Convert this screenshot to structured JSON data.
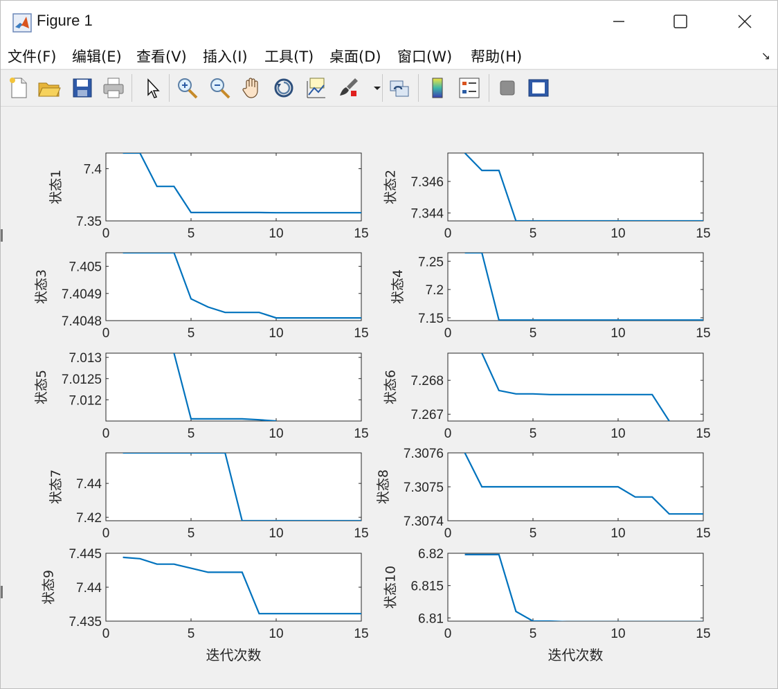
{
  "window": {
    "title": "Figure 1"
  },
  "menu": {
    "items": [
      "文件(F)",
      "编辑(E)",
      "查看(V)",
      "插入(I)",
      "工具(T)",
      "桌面(D)",
      "窗口(W)",
      "帮助(H)"
    ]
  },
  "toolbar": {
    "icons": [
      "new-figure-icon",
      "open-file-icon",
      "save-icon",
      "print-icon",
      "pointer-icon",
      "zoom-in-icon",
      "zoom-out-icon",
      "pan-hand-icon",
      "rotate-3d-icon",
      "data-cursor-icon",
      "brush-icon",
      "link-plot-icon",
      "colorbar-icon",
      "legend-icon",
      "hide-plot-tools-icon",
      "show-plot-tools-icon"
    ]
  },
  "colors": {
    "line": "#0072bd",
    "axes_bg": "#ffffff",
    "figure_bg": "#f0f0f0"
  },
  "chart_data": [
    {
      "type": "line",
      "ylabel": "状态1",
      "xlabel": "",
      "xlim": [
        0,
        15
      ],
      "xticks": [
        0,
        5,
        10,
        15
      ],
      "ylim": [
        7.35,
        7.415
      ],
      "yticks": [
        7.35,
        7.4
      ],
      "yticklabels": [
        "7.35",
        "7.4"
      ],
      "x": [
        1,
        2,
        3,
        4,
        5,
        6,
        7,
        8,
        9,
        10,
        11,
        12,
        13,
        14,
        15
      ],
      "y": [
        7.415,
        7.415,
        7.383,
        7.383,
        7.358,
        7.358,
        7.358,
        7.358,
        7.358,
        7.3578,
        7.3578,
        7.3578,
        7.3578,
        7.3578,
        7.3578
      ]
    },
    {
      "type": "line",
      "ylabel": "状态2",
      "xlabel": "",
      "xlim": [
        0,
        15
      ],
      "xticks": [
        0,
        5,
        10,
        15
      ],
      "ylim": [
        7.3435,
        7.3478
      ],
      "yticks": [
        7.344,
        7.346
      ],
      "yticklabels": [
        "7.344",
        "7.346"
      ],
      "x": [
        1,
        2,
        3,
        4,
        5,
        6,
        7,
        8,
        9,
        10,
        11,
        12,
        13,
        14,
        15
      ],
      "y": [
        7.3478,
        7.3467,
        7.3467,
        7.3435,
        7.3435,
        7.3435,
        7.3435,
        7.3435,
        7.3435,
        7.3435,
        7.3435,
        7.3435,
        7.3435,
        7.3435,
        7.3435
      ]
    },
    {
      "type": "line",
      "ylabel": "状态3",
      "xlabel": "",
      "xlim": [
        0,
        15
      ],
      "xticks": [
        0,
        5,
        10,
        15
      ],
      "ylim": [
        7.4048,
        7.40505
      ],
      "yticks": [
        7.4048,
        7.4049,
        7.405
      ],
      "yticklabels": [
        "7.4048",
        "7.4049",
        "7.405"
      ],
      "x": [
        1,
        2,
        3,
        4,
        5,
        6,
        7,
        8,
        9,
        10,
        11,
        12,
        13,
        14,
        15
      ],
      "y": [
        7.40505,
        7.40505,
        7.40505,
        7.40505,
        7.40488,
        7.40485,
        7.40483,
        7.40483,
        7.40483,
        7.40481,
        7.40481,
        7.40481,
        7.40481,
        7.40481,
        7.40481
      ]
    },
    {
      "type": "line",
      "ylabel": "状态4",
      "xlabel": "",
      "xlim": [
        0,
        15
      ],
      "xticks": [
        0,
        5,
        10,
        15
      ],
      "ylim": [
        7.145,
        7.265
      ],
      "yticks": [
        7.15,
        7.2,
        7.25
      ],
      "yticklabels": [
        "7.15",
        "7.2",
        "7.25"
      ],
      "x": [
        1,
        2,
        3,
        4,
        5,
        6,
        7,
        8,
        9,
        10,
        11,
        12,
        13,
        14,
        15
      ],
      "y": [
        7.265,
        7.265,
        7.146,
        7.146,
        7.146,
        7.146,
        7.146,
        7.146,
        7.146,
        7.146,
        7.146,
        7.146,
        7.146,
        7.146,
        7.146
      ]
    },
    {
      "type": "line",
      "ylabel": "状态5",
      "xlabel": "",
      "xlim": [
        0,
        15
      ],
      "xticks": [
        0,
        5,
        10,
        15
      ],
      "ylim": [
        7.0115,
        7.0131
      ],
      "yticks": [
        7.012,
        7.0125,
        7.013
      ],
      "yticklabels": [
        "7.012",
        "7.0125",
        "7.013"
      ],
      "x": [
        4,
        5,
        6,
        7,
        8,
        9,
        10
      ],
      "y": [
        7.0131,
        7.01155,
        7.01155,
        7.01155,
        7.01155,
        7.01153,
        7.0115
      ]
    },
    {
      "type": "line",
      "ylabel": "状态6",
      "xlabel": "",
      "xlim": [
        0,
        15
      ],
      "xticks": [
        0,
        5,
        10,
        15
      ],
      "ylim": [
        7.2668,
        7.2688
      ],
      "yticks": [
        7.267,
        7.268
      ],
      "yticklabels": [
        "7.267",
        "7.268"
      ],
      "x": [
        2,
        3,
        4,
        5,
        6,
        7,
        8,
        9,
        10,
        11,
        12,
        13
      ],
      "y": [
        7.2688,
        7.2677,
        7.2676,
        7.2676,
        7.26758,
        7.26758,
        7.26758,
        7.26758,
        7.26758,
        7.26758,
        7.26758,
        7.2668
      ]
    },
    {
      "type": "line",
      "ylabel": "状态7",
      "xlabel": "",
      "xlim": [
        0,
        15
      ],
      "xticks": [
        0,
        5,
        10,
        15
      ],
      "ylim": [
        7.418,
        7.458
      ],
      "yticks": [
        7.42,
        7.44
      ],
      "yticklabels": [
        "7.42",
        "7.44"
      ],
      "x": [
        1,
        2,
        3,
        4,
        5,
        6,
        7,
        8,
        9,
        10,
        11,
        12,
        13,
        14,
        15
      ],
      "y": [
        7.458,
        7.458,
        7.458,
        7.458,
        7.458,
        7.458,
        7.458,
        7.418,
        7.418,
        7.418,
        7.418,
        7.418,
        7.418,
        7.418,
        7.418
      ]
    },
    {
      "type": "line",
      "ylabel": "状态8",
      "xlabel": "",
      "xlim": [
        0,
        15
      ],
      "xticks": [
        0,
        5,
        10,
        15
      ],
      "ylim": [
        7.3074,
        7.3076
      ],
      "yticks": [
        7.3074,
        7.3075,
        7.3076
      ],
      "yticklabels": [
        "7.3074",
        "7.3075",
        "7.3076"
      ],
      "x": [
        1,
        2,
        3,
        4,
        5,
        6,
        7,
        8,
        9,
        10,
        11,
        12,
        13,
        14,
        15
      ],
      "y": [
        7.3076,
        7.3075,
        7.3075,
        7.3075,
        7.3075,
        7.3075,
        7.3075,
        7.3075,
        7.3075,
        7.3075,
        7.30747,
        7.30747,
        7.30742,
        7.30742,
        7.30742
      ]
    },
    {
      "type": "line",
      "ylabel": "状态9",
      "xlabel": "迭代次数",
      "xlim": [
        0,
        15
      ],
      "xticks": [
        0,
        5,
        10,
        15
      ],
      "ylim": [
        7.435,
        7.445
      ],
      "yticks": [
        7.435,
        7.44,
        7.445
      ],
      "yticklabels": [
        "7.435",
        "7.44",
        "7.445"
      ],
      "x": [
        1,
        2,
        3,
        4,
        5,
        6,
        7,
        8,
        9,
        10,
        11,
        12,
        13,
        14,
        15
      ],
      "y": [
        7.4444,
        7.4442,
        7.4434,
        7.4434,
        7.4428,
        7.4422,
        7.4422,
        7.4422,
        7.4361,
        7.4361,
        7.4361,
        7.4361,
        7.4361,
        7.4361,
        7.4361
      ]
    },
    {
      "type": "line",
      "ylabel": "状态10",
      "xlabel": "迭代次数",
      "xlim": [
        0,
        15
      ],
      "xticks": [
        0,
        5,
        10,
        15
      ],
      "ylim": [
        6.8095,
        6.82
      ],
      "yticks": [
        6.81,
        6.815,
        6.82
      ],
      "yticklabels": [
        "6.81",
        "6.815",
        "6.82"
      ],
      "x": [
        1,
        2,
        3,
        4,
        5,
        6,
        7,
        8,
        9,
        10,
        11,
        12,
        13,
        14,
        15
      ],
      "y": [
        6.8198,
        6.8198,
        6.8198,
        6.811,
        6.8095,
        6.8095,
        6.8094,
        6.8094,
        6.8094,
        6.8094,
        6.8094,
        6.8094,
        6.8094,
        6.8094,
        6.8094
      ]
    }
  ]
}
